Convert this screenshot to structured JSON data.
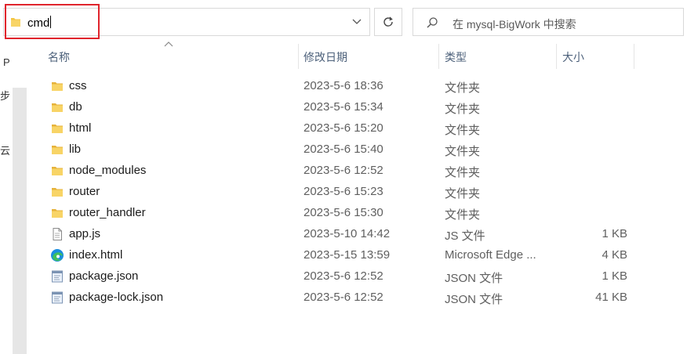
{
  "address_bar": {
    "value": "cmd"
  },
  "search": {
    "placeholder": "在 mysql-BigWork 中搜索"
  },
  "nav_fragments": [
    "P",
    "步",
    "云"
  ],
  "columns": {
    "name": "名称",
    "date": "修改日期",
    "type": "类型",
    "size": "大小"
  },
  "files": [
    {
      "name": "css",
      "date": "2023-5-6 18:36",
      "type": "文件夹",
      "size": "",
      "icon": "folder-icon"
    },
    {
      "name": "db",
      "date": "2023-5-6 15:34",
      "type": "文件夹",
      "size": "",
      "icon": "folder-icon"
    },
    {
      "name": "html",
      "date": "2023-5-6 15:20",
      "type": "文件夹",
      "size": "",
      "icon": "folder-icon"
    },
    {
      "name": "lib",
      "date": "2023-5-6 15:40",
      "type": "文件夹",
      "size": "",
      "icon": "folder-icon"
    },
    {
      "name": "node_modules",
      "date": "2023-5-6 12:52",
      "type": "文件夹",
      "size": "",
      "icon": "folder-icon"
    },
    {
      "name": "router",
      "date": "2023-5-6 15:23",
      "type": "文件夹",
      "size": "",
      "icon": "folder-icon"
    },
    {
      "name": "router_handler",
      "date": "2023-5-6 15:30",
      "type": "文件夹",
      "size": "",
      "icon": "folder-icon"
    },
    {
      "name": "app.js",
      "date": "2023-5-10 14:42",
      "type": "JS 文件",
      "size": "1 KB",
      "icon": "text-file-icon"
    },
    {
      "name": "index.html",
      "date": "2023-5-15 13:59",
      "type": "Microsoft Edge ...",
      "size": "4 KB",
      "icon": "edge-icon"
    },
    {
      "name": "package.json",
      "date": "2023-5-6 12:52",
      "type": "JSON 文件",
      "size": "1 KB",
      "icon": "json-file-icon"
    },
    {
      "name": "package-lock.json",
      "date": "2023-5-6 12:52",
      "type": "JSON 文件",
      "size": "41 KB",
      "icon": "json-file-icon"
    }
  ],
  "colors": {
    "folder": "#f4c542",
    "highlight": "#e0242c",
    "header_text": "#4c607a"
  }
}
